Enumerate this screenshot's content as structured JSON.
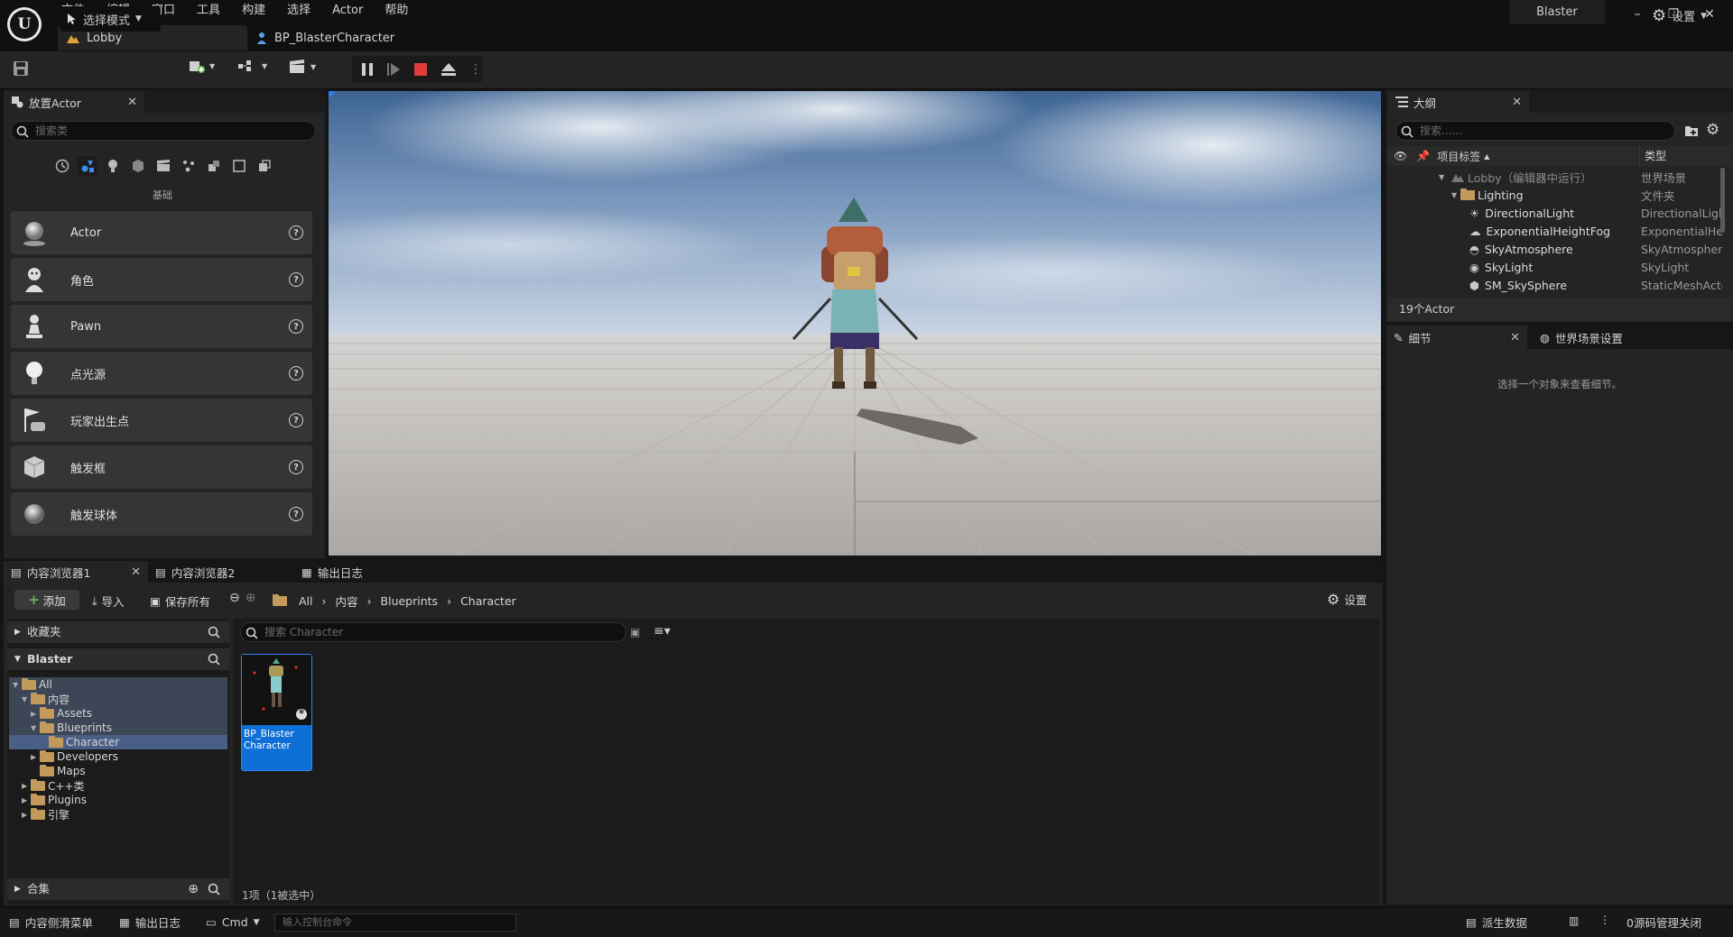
{
  "app": {
    "menu": [
      "文件",
      "编辑",
      "窗口",
      "工具",
      "构建",
      "选择",
      "Actor",
      "帮助"
    ],
    "tabs": [
      {
        "label": "Lobby"
      },
      {
        "label": "BP_BlasterCharacter"
      }
    ],
    "project_name": "Blaster"
  },
  "toolbar": {
    "mode_label": "选择模式",
    "settings_label": "设置"
  },
  "place_actors": {
    "tab_label": "放置Actor",
    "search_placeholder": "搜索类",
    "category_label": "基础",
    "items": [
      {
        "label": "Actor"
      },
      {
        "label": "角色"
      },
      {
        "label": "Pawn"
      },
      {
        "label": "点光源"
      },
      {
        "label": "玩家出生点"
      },
      {
        "label": "触发框"
      },
      {
        "label": "触发球体"
      }
    ]
  },
  "outliner": {
    "tab_label": "大纲",
    "search_placeholder": "搜索......",
    "col_label": "项目标签",
    "col_type": "类型",
    "rows": [
      {
        "name": "Lobby（编辑器中运行）",
        "type": "世界场景"
      },
      {
        "name": "Lighting",
        "type": "文件夹"
      },
      {
        "name": "DirectionalLight",
        "type": "DirectionalLight"
      },
      {
        "name": "ExponentialHeightFog",
        "type": "ExponentialHeightFog"
      },
      {
        "name": "SkyAtmosphere",
        "type": "SkyAtmosphere"
      },
      {
        "name": "SkyLight",
        "type": "SkyLight"
      },
      {
        "name": "SM_SkySphere",
        "type": "StaticMeshActor"
      }
    ],
    "count": "19个Actor"
  },
  "details": {
    "tab_label": "细节",
    "world_tab_label": "世界场景设置",
    "empty_text": "选择一个对象来查看细节。"
  },
  "content_browser": {
    "tabs": [
      "内容浏览器1",
      "内容浏览器2",
      "输出日志"
    ],
    "add_label": "添加",
    "import_label": "导入",
    "save_all_label": "保存所有",
    "breadcrumbs": [
      "All",
      "内容",
      "Blueprints",
      "Character"
    ],
    "settings_label": "设置",
    "favorites_label": "收藏夹",
    "project_label": "Blaster",
    "tree": [
      {
        "label": "All"
      },
      {
        "label": "内容"
      },
      {
        "label": "Assets"
      },
      {
        "label": "Blueprints"
      },
      {
        "label": "Character"
      },
      {
        "label": "Developers"
      },
      {
        "label": "Maps"
      },
      {
        "label": "C++类"
      },
      {
        "label": "Plugins"
      },
      {
        "label": "引擎"
      }
    ],
    "search_placeholder": "搜索 Character",
    "asset_name_line1": "BP_Blaster",
    "asset_name_line2": "Character",
    "status": "1项（1被选中）",
    "collections_label": "合集"
  },
  "statusbar": {
    "content_drawer": "内容侧滑菜单",
    "output_log": "输出日志",
    "cmd": "Cmd",
    "console_placeholder": "输入控制台命令",
    "derived_data": "派生数据",
    "source_control": "0源码管理关闭"
  }
}
